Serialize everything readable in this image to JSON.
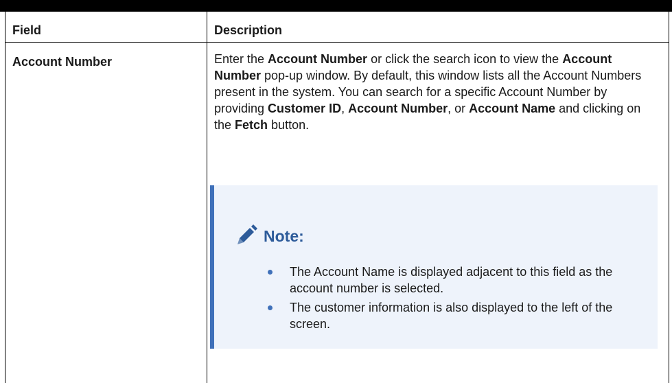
{
  "table": {
    "headers": {
      "field": "Field",
      "description": "Description"
    },
    "row": {
      "field": "Account Number",
      "description_parts": [
        "Enter the ",
        "Account Number",
        " or click the search icon to view the ",
        "Account Number",
        " pop-up window. By default, this window lists all the Account Numbers present in the system. You can search for a specific Account Number by providing ",
        "Customer ID",
        ", ",
        "Account Number",
        ", or ",
        "Account Name",
        " and clicking on the ",
        "Fetch",
        " button."
      ]
    }
  },
  "note": {
    "icon": "pencil-icon",
    "title": "Note:",
    "accent_color": "#3f70b9",
    "background_color": "#eef3fb",
    "bullets": [
      "The Account Name is displayed adjacent to this field as the account number is selected.",
      "The customer information is also displayed to the left of the screen."
    ]
  }
}
